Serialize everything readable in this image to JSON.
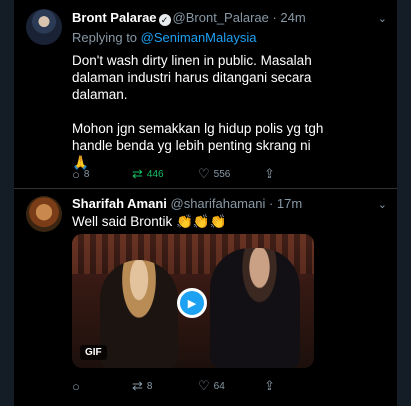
{
  "tweet1": {
    "name": "Bront Palarae",
    "handle": "@Bront_Palarae",
    "time": "· 24m",
    "replying_label": "Replying to",
    "replying_to": "@SenimanMalaysia",
    "text_lines": [
      "Don't wash dirty linen in public. Masalah",
      "dalaman industri harus ditangani secara",
      "dalaman.",
      "",
      "Mohon jgn semakkan lg hidup polis yg tgh",
      "handle benda yg lebih penting skrang ni",
      "🙏"
    ],
    "replies": "8",
    "retweets": "446",
    "likes": "556"
  },
  "tweet2": {
    "name": "Sharifah Amani",
    "handle": "@sharifahamani",
    "time": "· 17m",
    "text": "Well said Brontik 👏👏👏",
    "media_badge": "GIF",
    "replies": "",
    "retweets": "8",
    "likes": "64"
  },
  "icons": {
    "reply": "reply-icon",
    "retweet": "retweet-icon",
    "like": "heart-icon",
    "share": "share-icon",
    "more": "chevron-down-icon",
    "verified": "verified-badge-icon",
    "play": "play-icon"
  },
  "colors": {
    "background": "#000000",
    "link": "#1da1f2",
    "retweet_active": "#17bf63",
    "muted": "#8899a6"
  }
}
